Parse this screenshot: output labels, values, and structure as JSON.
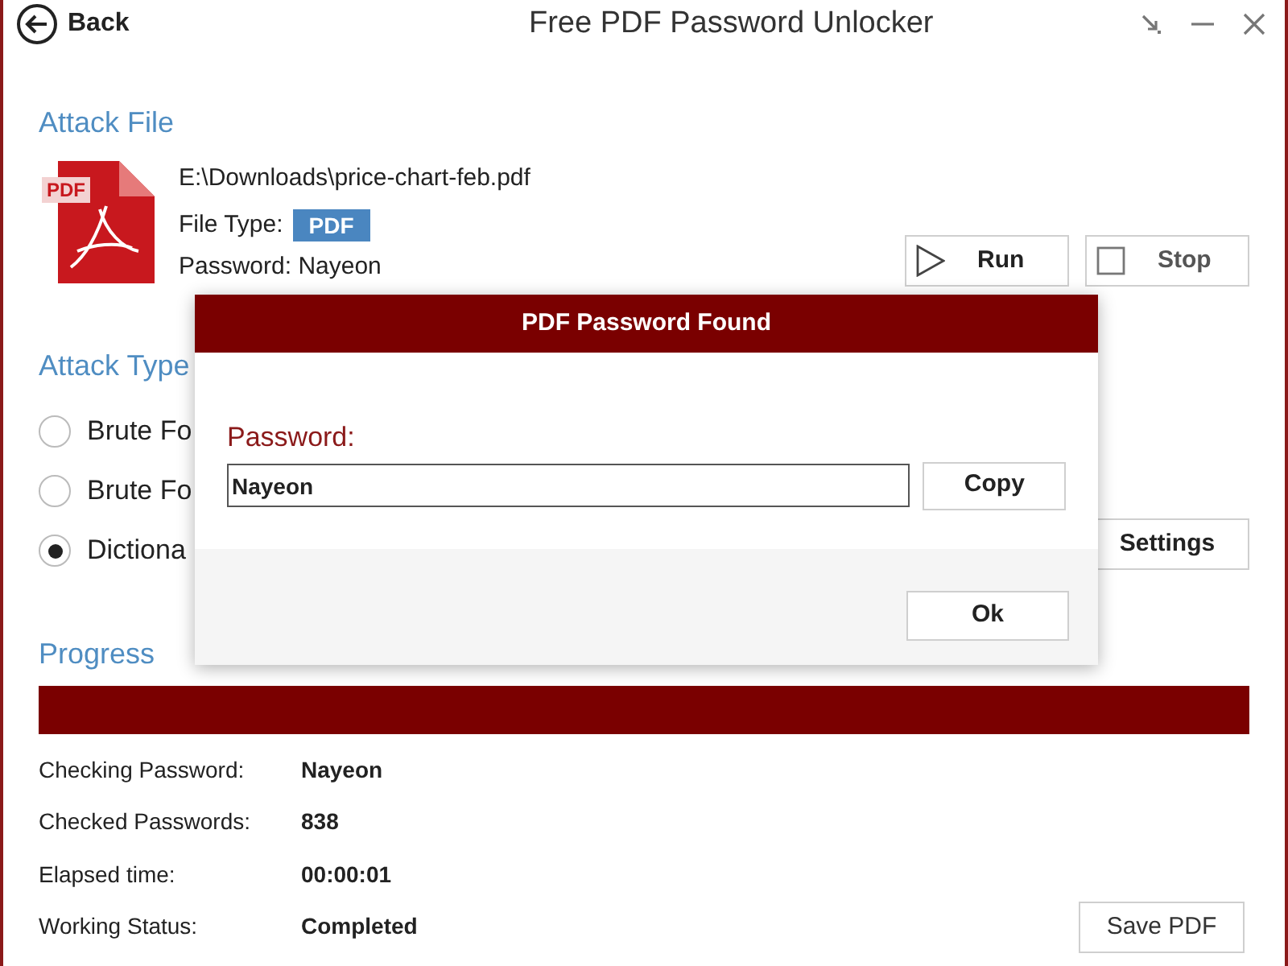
{
  "window": {
    "back": "Back",
    "title": "Free PDF Password Unlocker"
  },
  "attack_file": {
    "heading": "Attack File",
    "path": "E:\\Downloads\\price-chart-feb.pdf",
    "file_type_label": "File Type:",
    "file_type": "PDF",
    "password_line": "Password: Nayeon",
    "icon_badge": "PDF"
  },
  "actions": [
    {
      "label": "Run",
      "kind": "run"
    },
    {
      "label": "Stop",
      "kind": "stop"
    }
  ],
  "attack_type": {
    "heading": "Attack Type",
    "options": [
      {
        "label": "Brute Fo",
        "selected": false
      },
      {
        "label": "Brute Fo",
        "selected": false
      },
      {
        "label": "Dictiona",
        "selected": true
      }
    ],
    "settings": "Settings"
  },
  "progress": {
    "heading": "Progress",
    "stats": [
      {
        "label": "Checking Password:",
        "value": "Nayeon"
      },
      {
        "label": "Checked Passwords:",
        "value": "838"
      },
      {
        "label": "Elapsed time:",
        "value": "00:00:01"
      },
      {
        "label": "Working Status:",
        "value": "Completed"
      }
    ],
    "save": "Save PDF"
  },
  "dialog": {
    "title": "PDF Password Found",
    "label": "Password:",
    "value": "Nayeon",
    "copy": "Copy",
    "ok": "Ok"
  }
}
